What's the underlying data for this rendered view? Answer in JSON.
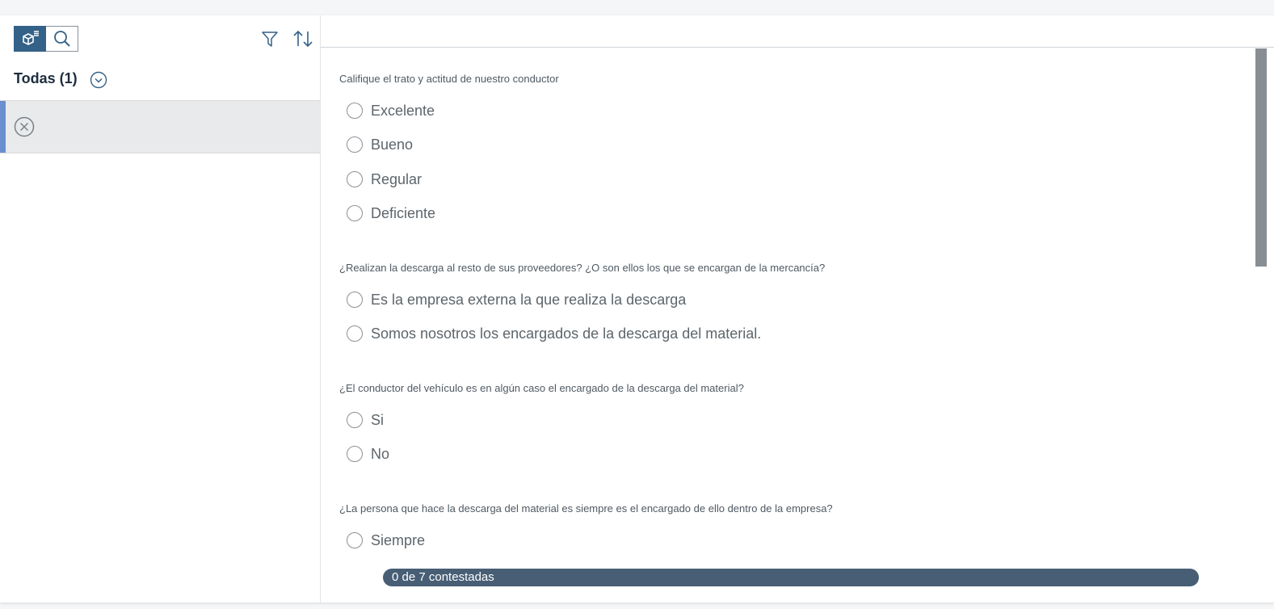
{
  "master": {
    "list_title": "Todas (1)",
    "toolbar": {
      "view_icon": "cube-list-icon",
      "search_icon": "search-icon",
      "filter_icon": "filter-icon",
      "sort_icon": "sort-icon"
    },
    "items": [
      {
        "status_icon": "close-circle-icon"
      }
    ]
  },
  "detail": {
    "questions": [
      {
        "text": "Califique el trato y actitud de nuestro conductor",
        "options": [
          "Excelente",
          "Bueno",
          "Regular",
          "Deficiente"
        ]
      },
      {
        "text": "¿Realizan la descarga al resto de sus proveedores? ¿O son ellos los que se encargan de la mercancía?",
        "options": [
          "Es la empresa externa la que realiza la descarga",
          "Somos nosotros los encargados de la descarga del material."
        ]
      },
      {
        "text": "¿El conductor del vehículo es en algún caso el encargado de la descarga del material?",
        "options": [
          "Si",
          "No"
        ]
      },
      {
        "text": "¿La persona que hace la descarga del material es siempre es el encargado de ello dentro de la empresa?",
        "options": [
          "Siempre"
        ]
      }
    ],
    "progress": {
      "label": "0 de 7 contestadas",
      "answered": 0,
      "total": 7
    }
  },
  "colors": {
    "accent": "#346187",
    "selection": "#6a8ed0",
    "progress_bg": "#475e75"
  }
}
